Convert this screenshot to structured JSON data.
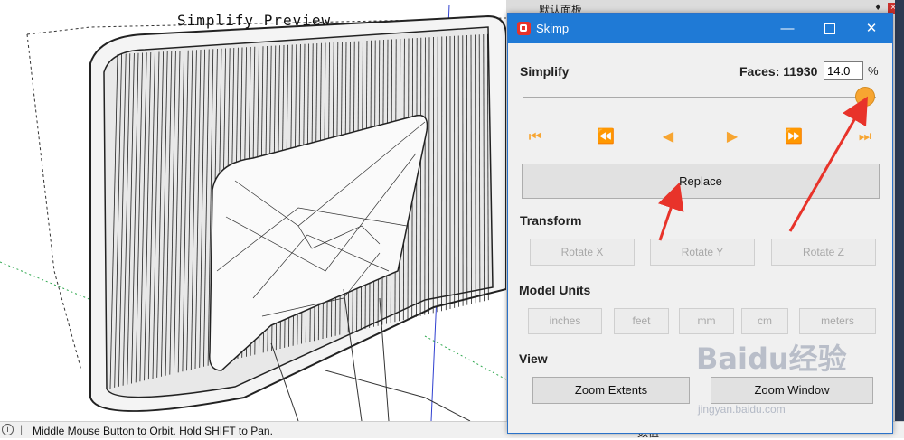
{
  "viewport": {
    "preview_title": "Simplify Preview"
  },
  "tray": {
    "title": "默认面板",
    "pin": "♦",
    "close": "×",
    "bottom_label": "数值"
  },
  "statusbar": {
    "info": "i",
    "text": "Middle Mouse Button to Orbit. Hold SHIFT to Pan."
  },
  "dialog": {
    "title": "Skimp",
    "controls": {
      "minimize": "—",
      "close": "✕"
    },
    "simplify": {
      "label": "Simplify",
      "faces_label": "Faces: 11930",
      "percent_value": "14.0",
      "percent_sign": "%",
      "slider_level": 0.97,
      "nav": [
        "⏮",
        "⏪",
        "◀",
        "▶",
        "⏩",
        "⏭"
      ],
      "replace_label": "Replace"
    },
    "transform": {
      "label": "Transform",
      "buttons": [
        "Rotate X",
        "Rotate Y",
        "Rotate Z"
      ]
    },
    "model_units": {
      "label": "Model Units",
      "buttons": [
        "inches",
        "feet",
        "mm",
        "cm",
        "meters"
      ]
    },
    "view": {
      "label": "View",
      "buttons": [
        "Zoom Extents",
        "Zoom Window"
      ]
    }
  },
  "watermark": {
    "text": "Baidu经验",
    "sub": "jingyan.baidu.com"
  },
  "colors": {
    "accent": "#1f7ad6",
    "nav_orange": "#f7a531",
    "arrow_red": "#e8332a"
  }
}
